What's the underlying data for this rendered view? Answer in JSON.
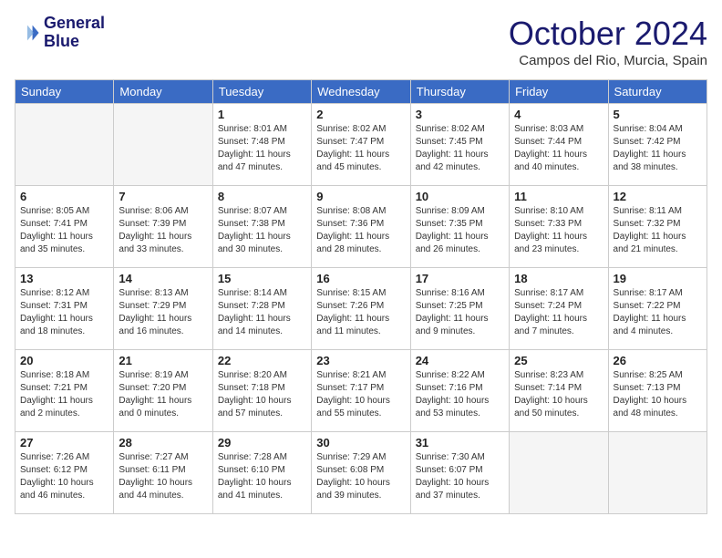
{
  "header": {
    "logo_line1": "General",
    "logo_line2": "Blue",
    "month_title": "October 2024",
    "location": "Campos del Rio, Murcia, Spain"
  },
  "days_of_week": [
    "Sunday",
    "Monday",
    "Tuesday",
    "Wednesday",
    "Thursday",
    "Friday",
    "Saturday"
  ],
  "weeks": [
    [
      {
        "day": "",
        "empty": true
      },
      {
        "day": "",
        "empty": true
      },
      {
        "day": "1",
        "sunrise": "Sunrise: 8:01 AM",
        "sunset": "Sunset: 7:48 PM",
        "daylight": "Daylight: 11 hours and 47 minutes."
      },
      {
        "day": "2",
        "sunrise": "Sunrise: 8:02 AM",
        "sunset": "Sunset: 7:47 PM",
        "daylight": "Daylight: 11 hours and 45 minutes."
      },
      {
        "day": "3",
        "sunrise": "Sunrise: 8:02 AM",
        "sunset": "Sunset: 7:45 PM",
        "daylight": "Daylight: 11 hours and 42 minutes."
      },
      {
        "day": "4",
        "sunrise": "Sunrise: 8:03 AM",
        "sunset": "Sunset: 7:44 PM",
        "daylight": "Daylight: 11 hours and 40 minutes."
      },
      {
        "day": "5",
        "sunrise": "Sunrise: 8:04 AM",
        "sunset": "Sunset: 7:42 PM",
        "daylight": "Daylight: 11 hours and 38 minutes."
      }
    ],
    [
      {
        "day": "6",
        "sunrise": "Sunrise: 8:05 AM",
        "sunset": "Sunset: 7:41 PM",
        "daylight": "Daylight: 11 hours and 35 minutes."
      },
      {
        "day": "7",
        "sunrise": "Sunrise: 8:06 AM",
        "sunset": "Sunset: 7:39 PM",
        "daylight": "Daylight: 11 hours and 33 minutes."
      },
      {
        "day": "8",
        "sunrise": "Sunrise: 8:07 AM",
        "sunset": "Sunset: 7:38 PM",
        "daylight": "Daylight: 11 hours and 30 minutes."
      },
      {
        "day": "9",
        "sunrise": "Sunrise: 8:08 AM",
        "sunset": "Sunset: 7:36 PM",
        "daylight": "Daylight: 11 hours and 28 minutes."
      },
      {
        "day": "10",
        "sunrise": "Sunrise: 8:09 AM",
        "sunset": "Sunset: 7:35 PM",
        "daylight": "Daylight: 11 hours and 26 minutes."
      },
      {
        "day": "11",
        "sunrise": "Sunrise: 8:10 AM",
        "sunset": "Sunset: 7:33 PM",
        "daylight": "Daylight: 11 hours and 23 minutes."
      },
      {
        "day": "12",
        "sunrise": "Sunrise: 8:11 AM",
        "sunset": "Sunset: 7:32 PM",
        "daylight": "Daylight: 11 hours and 21 minutes."
      }
    ],
    [
      {
        "day": "13",
        "sunrise": "Sunrise: 8:12 AM",
        "sunset": "Sunset: 7:31 PM",
        "daylight": "Daylight: 11 hours and 18 minutes."
      },
      {
        "day": "14",
        "sunrise": "Sunrise: 8:13 AM",
        "sunset": "Sunset: 7:29 PM",
        "daylight": "Daylight: 11 hours and 16 minutes."
      },
      {
        "day": "15",
        "sunrise": "Sunrise: 8:14 AM",
        "sunset": "Sunset: 7:28 PM",
        "daylight": "Daylight: 11 hours and 14 minutes."
      },
      {
        "day": "16",
        "sunrise": "Sunrise: 8:15 AM",
        "sunset": "Sunset: 7:26 PM",
        "daylight": "Daylight: 11 hours and 11 minutes."
      },
      {
        "day": "17",
        "sunrise": "Sunrise: 8:16 AM",
        "sunset": "Sunset: 7:25 PM",
        "daylight": "Daylight: 11 hours and 9 minutes."
      },
      {
        "day": "18",
        "sunrise": "Sunrise: 8:17 AM",
        "sunset": "Sunset: 7:24 PM",
        "daylight": "Daylight: 11 hours and 7 minutes."
      },
      {
        "day": "19",
        "sunrise": "Sunrise: 8:17 AM",
        "sunset": "Sunset: 7:22 PM",
        "daylight": "Daylight: 11 hours and 4 minutes."
      }
    ],
    [
      {
        "day": "20",
        "sunrise": "Sunrise: 8:18 AM",
        "sunset": "Sunset: 7:21 PM",
        "daylight": "Daylight: 11 hours and 2 minutes."
      },
      {
        "day": "21",
        "sunrise": "Sunrise: 8:19 AM",
        "sunset": "Sunset: 7:20 PM",
        "daylight": "Daylight: 11 hours and 0 minutes."
      },
      {
        "day": "22",
        "sunrise": "Sunrise: 8:20 AM",
        "sunset": "Sunset: 7:18 PM",
        "daylight": "Daylight: 10 hours and 57 minutes."
      },
      {
        "day": "23",
        "sunrise": "Sunrise: 8:21 AM",
        "sunset": "Sunset: 7:17 PM",
        "daylight": "Daylight: 10 hours and 55 minutes."
      },
      {
        "day": "24",
        "sunrise": "Sunrise: 8:22 AM",
        "sunset": "Sunset: 7:16 PM",
        "daylight": "Daylight: 10 hours and 53 minutes."
      },
      {
        "day": "25",
        "sunrise": "Sunrise: 8:23 AM",
        "sunset": "Sunset: 7:14 PM",
        "daylight": "Daylight: 10 hours and 50 minutes."
      },
      {
        "day": "26",
        "sunrise": "Sunrise: 8:25 AM",
        "sunset": "Sunset: 7:13 PM",
        "daylight": "Daylight: 10 hours and 48 minutes."
      }
    ],
    [
      {
        "day": "27",
        "sunrise": "Sunrise: 7:26 AM",
        "sunset": "Sunset: 6:12 PM",
        "daylight": "Daylight: 10 hours and 46 minutes."
      },
      {
        "day": "28",
        "sunrise": "Sunrise: 7:27 AM",
        "sunset": "Sunset: 6:11 PM",
        "daylight": "Daylight: 10 hours and 44 minutes."
      },
      {
        "day": "29",
        "sunrise": "Sunrise: 7:28 AM",
        "sunset": "Sunset: 6:10 PM",
        "daylight": "Daylight: 10 hours and 41 minutes."
      },
      {
        "day": "30",
        "sunrise": "Sunrise: 7:29 AM",
        "sunset": "Sunset: 6:08 PM",
        "daylight": "Daylight: 10 hours and 39 minutes."
      },
      {
        "day": "31",
        "sunrise": "Sunrise: 7:30 AM",
        "sunset": "Sunset: 6:07 PM",
        "daylight": "Daylight: 10 hours and 37 minutes."
      },
      {
        "day": "",
        "empty": true
      },
      {
        "day": "",
        "empty": true
      }
    ]
  ]
}
